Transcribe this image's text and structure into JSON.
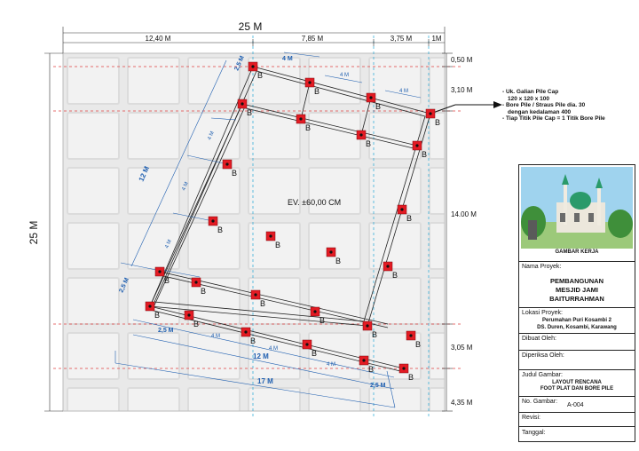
{
  "dimensions": {
    "top_total": "25 M",
    "left_total": "25 M",
    "top_segments": [
      "12,40 M",
      "7,85 M",
      "3,75 M",
      "1M"
    ],
    "right_segments": [
      "0,50 M",
      "3,10 M",
      "14.00 M",
      "3,05 M",
      "4,35 M"
    ],
    "grid_spacing": "4 M",
    "edge_spacing": "2,5 M",
    "long_side": "17 M",
    "short_side": "12 M",
    "elevation": "EV. ±60,00 CM"
  },
  "pile_label": "B",
  "notes": [
    "- Uk. Galian Pile Cap",
    "  120 x 120 x 100",
    "- Bore Pile / Straus Pile dia. 30",
    "  dengan kedalaman 400",
    "- Tiap Titik Pile Cap = 1 Titik Bore Pile"
  ],
  "title_block": {
    "image_caption": "GAMBAR KERJA",
    "project_label": "Nama Proyek:",
    "project_name": [
      "PEMBANGUNAN",
      "MESJID JAMI",
      "BAITURRAHMAN"
    ],
    "location_label": "Lokasi Proyek:",
    "location_value": [
      "Perumahan Puri Kosambi 2",
      "DS. Duren, Kosambi, Karawang"
    ],
    "made_by_label": "Dibuat Oleh:",
    "checked_by_label": "Diperiksa Oleh:",
    "drawing_title_label": "Judul Gambar:",
    "drawing_title_value": [
      "LAYOUT RENCANA",
      "FOOT PLAT DAN BORE PILE"
    ],
    "drawing_no_label": "No. Gambar:",
    "drawing_no_value": "A-004",
    "revision_label": "Revisi:",
    "date_label": "Tanggal:"
  },
  "colors": {
    "pile": "#e31b23",
    "dimension": "#1f5fb0",
    "grid_dash": "#e04040",
    "cyan_dash": "#22a6d6"
  }
}
